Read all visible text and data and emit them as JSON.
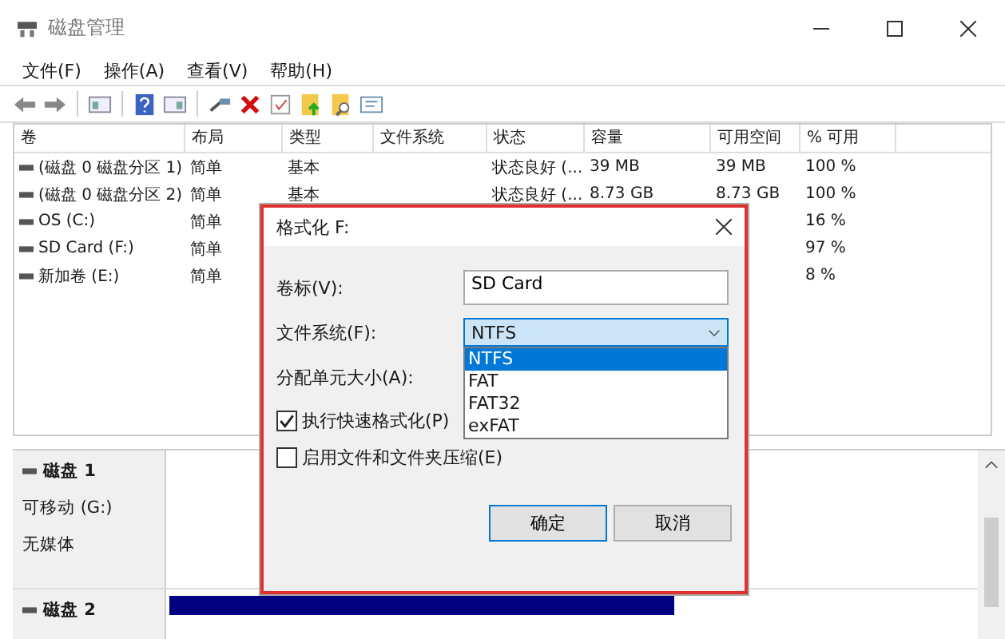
{
  "window": {
    "title": "磁盘管理"
  },
  "menu": [
    "文件(F)",
    "操作(A)",
    "查看(V)",
    "帮助(H)"
  ],
  "table": {
    "columns": [
      "卷",
      "布局",
      "类型",
      "文件系统",
      "状态",
      "容量",
      "可用空间",
      "% 可用"
    ],
    "rows": [
      {
        "volume": "(磁盘 0 磁盘分区 1)",
        "layout": "简单",
        "type": "基本",
        "status": "状态良好 (...",
        "capacity": "39 MB",
        "free": "39 MB",
        "pct": "100 %"
      },
      {
        "volume": "(磁盘 0 磁盘分区 2)",
        "layout": "简单",
        "type": "基本",
        "status": "状态良好 (...",
        "capacity": "8.73 GB",
        "free": "8.73 GB",
        "pct": "100 %"
      },
      {
        "volume": "OS (C:)",
        "layout": "简单",
        "pct": "16 %"
      },
      {
        "volume": "SD Card (F:)",
        "layout": "简单",
        "pct": "97 %"
      },
      {
        "volume": "新加卷 (E:)",
        "layout": "简单",
        "pct": "8 %"
      }
    ]
  },
  "disks": [
    {
      "name": "磁盘 1",
      "lines": [
        "可移动 (G:)",
        "无媒体"
      ],
      "partition": false
    },
    {
      "name": "磁盘 2",
      "partition": true
    }
  ],
  "dialog": {
    "title": "格式化 F:",
    "volume_label": {
      "label": "卷标(V):",
      "value": "SD Card"
    },
    "file_system": {
      "label": "文件系统(F):",
      "value": "NTFS",
      "expanded": true,
      "options": [
        {
          "label": "NTFS",
          "selected": true
        },
        {
          "label": "FAT",
          "selected": false
        },
        {
          "label": "FAT32",
          "selected": false
        },
        {
          "label": "exFAT",
          "selected": false
        }
      ]
    },
    "allocation": {
      "label": "分配单元大小(A):"
    },
    "checkboxes": [
      {
        "label": "执行快速格式化(P)",
        "checked": true
      },
      {
        "label": "启用文件和文件夹压缩(E)",
        "checked": false
      }
    ],
    "buttons": [
      {
        "label": "确定",
        "kind": "default"
      },
      {
        "label": "取消",
        "kind": "normal"
      }
    ]
  }
}
